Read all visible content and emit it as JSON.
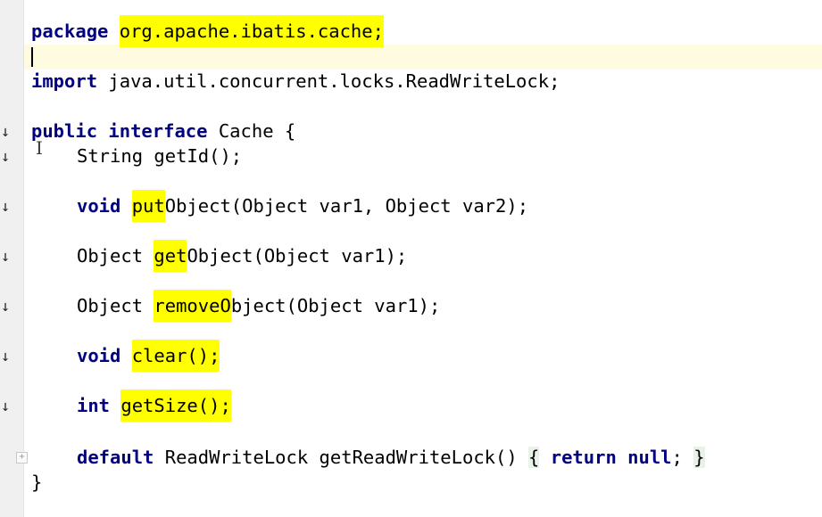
{
  "editor": {
    "package_keyword": "package",
    "package_name": "org.apache.ibatis.cache;",
    "import_keyword": "import",
    "import_path": "java.util.concurrent.locks.ReadWriteLock;",
    "iface_kw1": "public",
    "iface_kw2": "interface",
    "iface_rest": "Cache {",
    "m1": {
      "text": "String getId();"
    },
    "m2": {
      "kw": "void",
      "hl": "put",
      "rest": "Object(Object var1, Object var2);"
    },
    "m3": {
      "pre": "Object ",
      "hl": "get",
      "rest": "Object(Object var1);"
    },
    "m4": {
      "pre": "Object ",
      "hl": "removeO",
      "rest": "bject(Object var1);"
    },
    "m5": {
      "kw": "void",
      "hl": "clear();"
    },
    "m6": {
      "kw": "int",
      "hl": "getSize();"
    },
    "m7": {
      "kw": "default",
      "mid": "ReadWriteLock getReadWriteLock()",
      "brace_open": "{",
      "kw_return": "return",
      "kw_null": "null",
      "semi": ";",
      "brace_close": "}"
    },
    "closing_brace": "}"
  },
  "gutter": {
    "marker_icon": "↓",
    "fold_icon": "+"
  },
  "colors": {
    "keyword": "#000080",
    "highlight": "#ffff00",
    "caret_line": "#fffbe0"
  }
}
